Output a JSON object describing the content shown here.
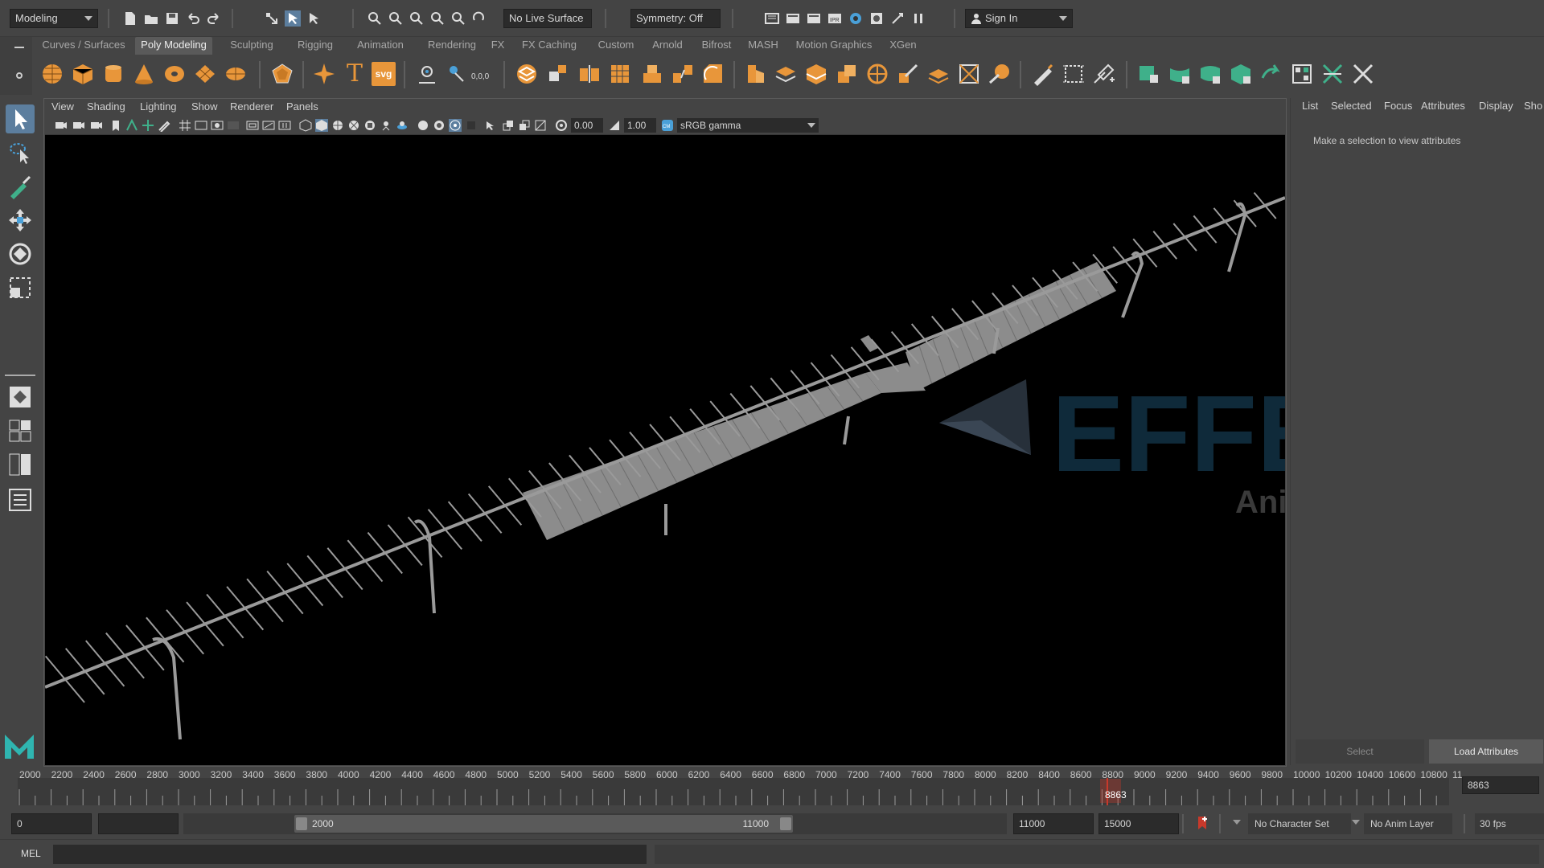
{
  "statusline": {
    "mode_menu": "Modeling",
    "live_surface": "No Live Surface",
    "symmetry": "Symmetry: Off",
    "sign_in": "Sign In"
  },
  "shelf": {
    "tabs": [
      {
        "label": "Curves / Surfaces"
      },
      {
        "label": "Poly Modeling"
      },
      {
        "label": "Sculpting"
      },
      {
        "label": "Rigging"
      },
      {
        "label": "Animation"
      },
      {
        "label": "Rendering"
      },
      {
        "label": "FX"
      },
      {
        "label": "FX Caching"
      },
      {
        "label": "Custom"
      },
      {
        "label": "Arnold"
      },
      {
        "label": "Bifrost"
      },
      {
        "label": "MASH"
      },
      {
        "label": "Motion Graphics"
      },
      {
        "label": "XGen"
      }
    ],
    "active_tab": "Poly Modeling",
    "text_icon": "T",
    "svg_icon": "svg",
    "coord_icon": "0,0,0"
  },
  "viewport": {
    "menu": [
      {
        "label": "View"
      },
      {
        "label": "Shading"
      },
      {
        "label": "Lighting"
      },
      {
        "label": "Show"
      },
      {
        "label": "Renderer"
      },
      {
        "label": "Panels"
      }
    ],
    "exposure": "0.00",
    "gamma": "1.00",
    "color_space": "sRGB gamma",
    "watermark": {
      "text": "EFFE",
      "sub": "Animation"
    }
  },
  "attribute_editor": {
    "tabs": [
      {
        "label": "List"
      },
      {
        "label": "Selected"
      },
      {
        "label": "Focus"
      },
      {
        "label": "Attributes"
      },
      {
        "label": "Display"
      },
      {
        "label": "Sho"
      }
    ],
    "message": "Make a selection to view attributes",
    "select_button": "Select",
    "load_button": "Load Attributes"
  },
  "timeline": {
    "ticks": [
      "2000",
      "2200",
      "2400",
      "2600",
      "2800",
      "3000",
      "3200",
      "3400",
      "3600",
      "3800",
      "4000",
      "4200",
      "4400",
      "4600",
      "4800",
      "5000",
      "5200",
      "5400",
      "5600",
      "5800",
      "6000",
      "6200",
      "6400",
      "6600",
      "6800",
      "7000",
      "7200",
      "7400",
      "7600",
      "7800",
      "8000",
      "8200",
      "8400",
      "8600",
      "8800",
      "9000",
      "9200",
      "9400",
      "9600",
      "9800",
      "10000",
      "10200",
      "10400",
      "10600",
      "10800",
      "11"
    ],
    "current_frame": "8863",
    "current_frame_field": "8863"
  },
  "range": {
    "start_time": "0",
    "range_start": "2000",
    "range_end": "11000",
    "end_field": "11000",
    "anim_end": "15000",
    "character_set": "No Character Set",
    "anim_layer": "No Anim Layer",
    "fps": "30 fps"
  },
  "command_line": {
    "language": "MEL"
  },
  "colors": {
    "ui_bg": "#444444",
    "field_bg": "#2b2b2b",
    "accent_blue": "#5c7e9e",
    "shelf_orange": "#e8963a",
    "shelf_blue": "#4aa0d8",
    "shelf_green": "#3fb08a",
    "current_frame_red": "#c8392b"
  }
}
